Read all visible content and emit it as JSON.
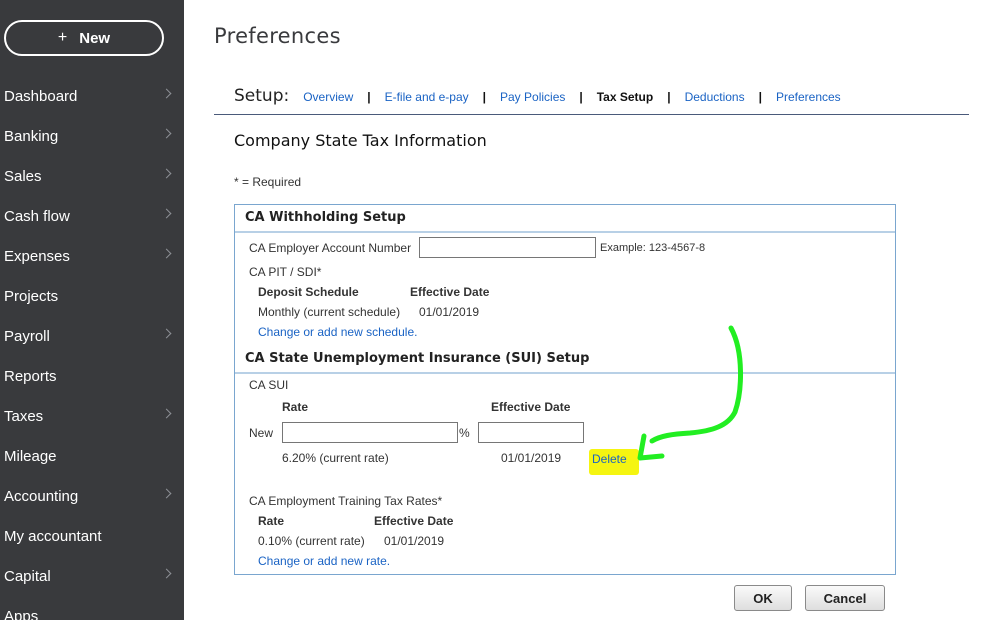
{
  "sidebar": {
    "new_label": "New",
    "new_icon": "+",
    "items": [
      {
        "label": "Dashboard",
        "chevron": true
      },
      {
        "label": "Banking",
        "chevron": true
      },
      {
        "label": "Sales",
        "chevron": true
      },
      {
        "label": "Cash flow",
        "chevron": true
      },
      {
        "label": "Expenses",
        "chevron": true
      },
      {
        "label": "Projects",
        "chevron": false
      },
      {
        "label": "Payroll",
        "chevron": true
      },
      {
        "label": "Reports",
        "chevron": false
      },
      {
        "label": "Taxes",
        "chevron": true
      },
      {
        "label": "Mileage",
        "chevron": false
      },
      {
        "label": "Accounting",
        "chevron": true
      },
      {
        "label": "My accountant",
        "chevron": false
      },
      {
        "label": "Capital",
        "chevron": true
      },
      {
        "label": "Apps",
        "chevron": false
      }
    ]
  },
  "page_title": "Preferences",
  "setup": {
    "label": "Setup:",
    "separator": "|",
    "links": [
      {
        "label": "Overview",
        "active": false
      },
      {
        "label": "E-file and e-pay",
        "active": false
      },
      {
        "label": "Pay Policies",
        "active": false
      },
      {
        "label": "Tax Setup",
        "active": true
      },
      {
        "label": "Deductions",
        "active": false
      },
      {
        "label": "Preferences",
        "active": false
      }
    ]
  },
  "section_title": "Company State Tax Information",
  "required_note": "* = Required",
  "withholding": {
    "title": "CA Withholding Setup",
    "account_label": "CA Employer Account Number",
    "account_value": "",
    "account_example": "Example: 123-4567-8",
    "pit_label": "CA PIT / SDI*",
    "col_schedule": "Deposit Schedule",
    "col_date": "Effective Date",
    "schedule_value": "Monthly (current schedule)",
    "date_value": "01/01/2019",
    "change_link": "Change or add new schedule."
  },
  "sui": {
    "title": "CA State Unemployment Insurance (SUI) Setup",
    "sui_label": "CA SUI",
    "col_rate": "Rate",
    "col_date": "Effective Date",
    "new_label": "New",
    "rate_value": "",
    "percent": "%",
    "date_value": "",
    "current_rate": "6.20% (current rate)",
    "current_date": "01/01/2019",
    "delete_label": "Delete"
  },
  "ett": {
    "label": "CA Employment Training Tax Rates*",
    "col_rate": "Rate",
    "col_date": "Effective Date",
    "rate_value": "0.10% (current rate)",
    "date_value": "01/01/2019",
    "change_link": "Change or add new rate."
  },
  "buttons": {
    "ok": "OK",
    "cancel": "Cancel"
  },
  "colors": {
    "sidebar_bg": "#393a3d",
    "link": "#1a63c4",
    "highlight": "#f5f511",
    "arrow": "#22ee22"
  }
}
